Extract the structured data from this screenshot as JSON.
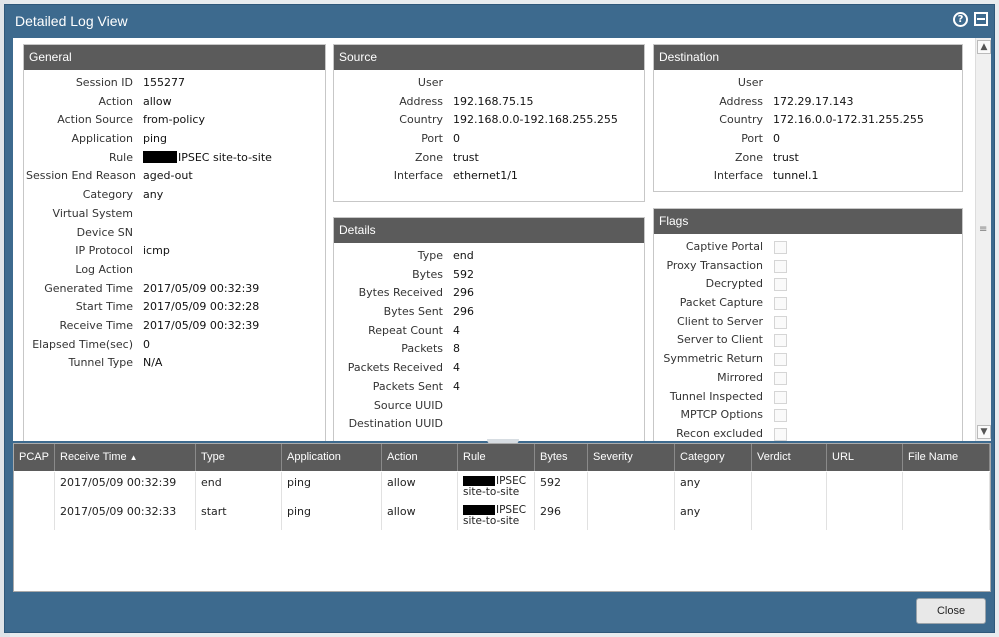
{
  "dialog": {
    "title": "Detailed Log View",
    "close_label": "Close"
  },
  "general": {
    "title": "General",
    "rows": [
      {
        "k": "Session ID",
        "v": "155277"
      },
      {
        "k": "Action",
        "v": "allow"
      },
      {
        "k": "Action Source",
        "v": "from-policy"
      },
      {
        "k": "Application",
        "v": "ping"
      },
      {
        "k": "Rule",
        "v": "IPSEC site-to-site",
        "redacted": true
      },
      {
        "k": "Session End Reason",
        "v": "aged-out"
      },
      {
        "k": "Category",
        "v": "any"
      },
      {
        "k": "Virtual System",
        "v": ""
      },
      {
        "k": "Device SN",
        "v": ""
      },
      {
        "k": "IP Protocol",
        "v": "icmp"
      },
      {
        "k": "Log Action",
        "v": ""
      },
      {
        "k": "Generated Time",
        "v": "2017/05/09 00:32:39"
      },
      {
        "k": "Start Time",
        "v": "2017/05/09 00:32:28"
      },
      {
        "k": "Receive Time",
        "v": "2017/05/09 00:32:39"
      },
      {
        "k": "Elapsed Time(sec)",
        "v": "0"
      },
      {
        "k": "Tunnel Type",
        "v": "N/A"
      }
    ]
  },
  "source": {
    "title": "Source",
    "rows": [
      {
        "k": "User",
        "v": ""
      },
      {
        "k": "Address",
        "v": "192.168.75.15"
      },
      {
        "k": "Country",
        "v": "192.168.0.0-192.168.255.255"
      },
      {
        "k": "Port",
        "v": "0"
      },
      {
        "k": "Zone",
        "v": "trust"
      },
      {
        "k": "Interface",
        "v": "ethernet1/1"
      }
    ]
  },
  "destination": {
    "title": "Destination",
    "rows": [
      {
        "k": "User",
        "v": ""
      },
      {
        "k": "Address",
        "v": "172.29.17.143"
      },
      {
        "k": "Country",
        "v": "172.16.0.0-172.31.255.255"
      },
      {
        "k": "Port",
        "v": "0"
      },
      {
        "k": "Zone",
        "v": "trust"
      },
      {
        "k": "Interface",
        "v": "tunnel.1"
      }
    ]
  },
  "details": {
    "title": "Details",
    "rows": [
      {
        "k": "Type",
        "v": "end"
      },
      {
        "k": "Bytes",
        "v": "592"
      },
      {
        "k": "Bytes Received",
        "v": "296"
      },
      {
        "k": "Bytes Sent",
        "v": "296"
      },
      {
        "k": "Repeat Count",
        "v": "4"
      },
      {
        "k": "Packets",
        "v": "8"
      },
      {
        "k": "Packets Received",
        "v": "4"
      },
      {
        "k": "Packets Sent",
        "v": "4"
      },
      {
        "k": "Source UUID",
        "v": ""
      },
      {
        "k": "Destination UUID",
        "v": ""
      }
    ]
  },
  "flags": {
    "title": "Flags",
    "items": [
      "Captive Portal",
      "Proxy Transaction",
      "Decrypted",
      "Packet Capture",
      "Client to Server",
      "Server to Client",
      "Symmetric Return",
      "Mirrored",
      "Tunnel Inspected",
      "MPTCP Options",
      "Recon excluded"
    ]
  },
  "table": {
    "columns": [
      "PCAP",
      "Receive Time",
      "Type",
      "Application",
      "Action",
      "Rule",
      "Bytes",
      "Severity",
      "Category",
      "Verdict",
      "URL",
      "File Name"
    ],
    "sorted_column": "Receive Time",
    "rows": [
      {
        "pcap": "",
        "receive_time": "2017/05/09 00:32:39",
        "type": "end",
        "application": "ping",
        "action": "allow",
        "rule_line1": "IPSEC",
        "rule_line2": "site-to-site",
        "bytes": "592",
        "severity": "",
        "category": "any",
        "verdict": "",
        "url": "",
        "file_name": ""
      },
      {
        "pcap": "",
        "receive_time": "2017/05/09 00:32:33",
        "type": "start",
        "application": "ping",
        "action": "allow",
        "rule_line1": "IPSEC",
        "rule_line2": "site-to-site",
        "bytes": "296",
        "severity": "",
        "category": "any",
        "verdict": "",
        "url": "",
        "file_name": ""
      }
    ]
  },
  "icons": {
    "help": "help-icon",
    "maximize": "maximize-icon",
    "sort_asc": "sort-ascending-icon",
    "scroll_up": "scroll-up-icon",
    "scroll_down": "scroll-down-icon"
  },
  "colors": {
    "dialog_frame": "#3d6a8e",
    "panel_header": "#5b5b5b"
  }
}
